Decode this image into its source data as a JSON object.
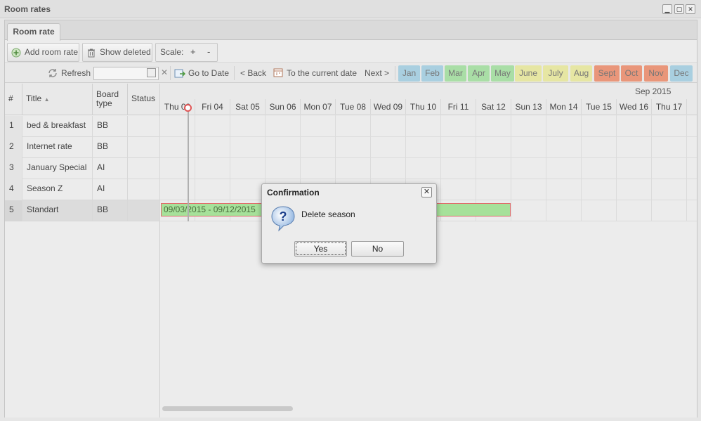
{
  "window": {
    "title": "Room rates",
    "controls": [
      "minimize-icon",
      "maximize-icon",
      "close-icon"
    ]
  },
  "tab": {
    "label": "Room rate"
  },
  "toolbar": {
    "add_label": "Add room rate",
    "show_deleted_label": "Show deleted",
    "scale_label": "Scale:",
    "zoom_in": "+",
    "zoom_out": "-"
  },
  "navbar": {
    "refresh": "Refresh",
    "date_input": "",
    "clear": "✕",
    "go_to_date": "Go to Date",
    "back": "< Back",
    "current_date": "To the current date",
    "next": "Next >",
    "months": [
      {
        "label": "Jan",
        "color": "#a9cfe0"
      },
      {
        "label": "Feb",
        "color": "#a9cfe0"
      },
      {
        "label": "Mar",
        "color": "#a9dea6"
      },
      {
        "label": "Apr",
        "color": "#a9dea6"
      },
      {
        "label": "May",
        "color": "#a9dea6"
      },
      {
        "label": "June",
        "color": "#e6e6a3"
      },
      {
        "label": "July",
        "color": "#e6e6a3"
      },
      {
        "label": "Aug",
        "color": "#e6e6a3"
      },
      {
        "label": "Sept",
        "color": "#e9967a"
      },
      {
        "label": "Oct",
        "color": "#e9967a"
      },
      {
        "label": "Nov",
        "color": "#e9967a"
      },
      {
        "label": "Dec",
        "color": "#a9cfe0"
      }
    ]
  },
  "table": {
    "headers": {
      "num": "#",
      "title": "Title",
      "board": "Board type",
      "status": "Status"
    },
    "rows": [
      {
        "num": "1",
        "title": "bed & breakfast",
        "board": "BB",
        "status": ""
      },
      {
        "num": "2",
        "title": "Internet rate",
        "board": "BB",
        "status": ""
      },
      {
        "num": "3",
        "title": "January Special",
        "board": "AI",
        "status": ""
      },
      {
        "num": "4",
        "title": "Season Z",
        "board": "AI",
        "status": ""
      },
      {
        "num": "5",
        "title": "Standart",
        "board": "BB",
        "status": ""
      }
    ]
  },
  "schedule": {
    "month_label": "Sep 2015",
    "days": [
      "Thu 03",
      "Fri 04",
      "Sat 05",
      "Sun 06",
      "Mon 07",
      "Tue 08",
      "Wed 09",
      "Thu 10",
      "Fri 11",
      "Sat 12",
      "Sun 13",
      "Mon 14",
      "Tue 15",
      "Wed 16",
      "Thu 17"
    ],
    "season_label": "09/03/2015 - 09/12/2015"
  },
  "dialog": {
    "title": "Confirmation",
    "message": "Delete season",
    "yes": "Yes",
    "no": "No"
  }
}
